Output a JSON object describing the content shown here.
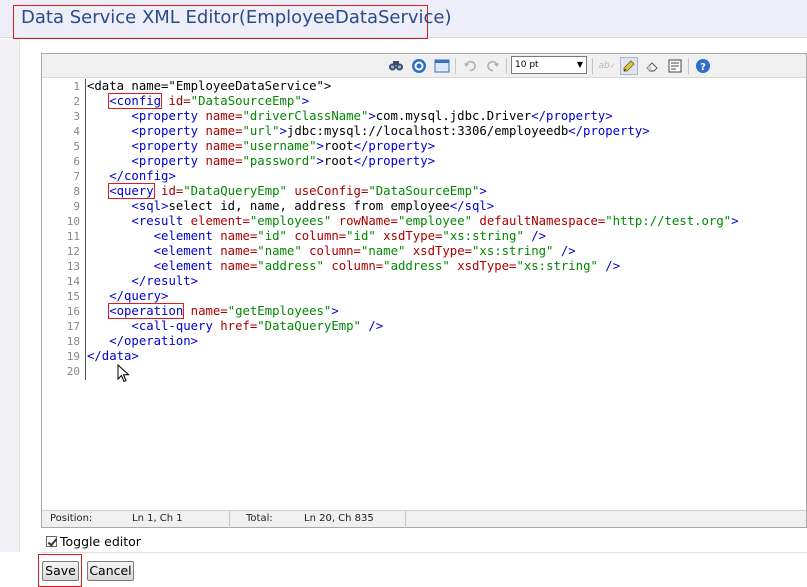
{
  "page": {
    "title": "Data Service XML Editor(EmployeeDataService)"
  },
  "toolbar": {
    "font_size": "10 pt",
    "buttons": [
      {
        "name": "find-icon",
        "glyph": "🔍"
      },
      {
        "name": "goto-line-icon",
        "glyph": "◉"
      },
      {
        "name": "fullscreen-icon",
        "glyph": "▭"
      },
      {
        "name": "undo-icon",
        "glyph": "↶"
      },
      {
        "name": "redo-icon",
        "glyph": "↷"
      },
      {
        "name": "spellcheck-icon",
        "glyph": "ab"
      },
      {
        "name": "highlight-icon",
        "glyph": "✎"
      },
      {
        "name": "reset-highlight-icon",
        "glyph": "⌫"
      },
      {
        "name": "word-wrap-icon",
        "glyph": "▤"
      },
      {
        "name": "help-icon",
        "glyph": "?"
      }
    ]
  },
  "editor": {
    "line_numbers": [
      "1",
      "2",
      "3",
      "4",
      "5",
      "6",
      "7",
      "8",
      "9",
      "10",
      "11",
      "12",
      "13",
      "14",
      "15",
      "16",
      "17",
      "18",
      "19",
      "20"
    ],
    "lines": [
      [
        [
          "x",
          "<data name=\"EmployeeDataService\">"
        ]
      ],
      [
        [
          "x",
          "   "
        ],
        [
          "t",
          "<config",
          "hl"
        ],
        [
          "a",
          " id="
        ],
        [
          "v",
          "\"DataSourceEmp\""
        ],
        [
          "t",
          ">"
        ]
      ],
      [
        [
          "x",
          "      "
        ],
        [
          "t",
          "<property"
        ],
        [
          "a",
          " name="
        ],
        [
          "v",
          "\"driverClassName\""
        ],
        [
          "t",
          ">"
        ],
        [
          "x",
          "com.mysql.jdbc.Driver"
        ],
        [
          "t",
          "</property>"
        ]
      ],
      [
        [
          "x",
          "      "
        ],
        [
          "t",
          "<property"
        ],
        [
          "a",
          " name="
        ],
        [
          "v",
          "\"url\""
        ],
        [
          "t",
          ">"
        ],
        [
          "x",
          "jdbc:mysql://localhost:3306/employeedb"
        ],
        [
          "t",
          "</property>"
        ]
      ],
      [
        [
          "x",
          "      "
        ],
        [
          "t",
          "<property"
        ],
        [
          "a",
          " name="
        ],
        [
          "v",
          "\"username\""
        ],
        [
          "t",
          ">"
        ],
        [
          "x",
          "root"
        ],
        [
          "t",
          "</property>"
        ]
      ],
      [
        [
          "x",
          "      "
        ],
        [
          "t",
          "<property"
        ],
        [
          "a",
          " name="
        ],
        [
          "v",
          "\"password\""
        ],
        [
          "t",
          ">"
        ],
        [
          "x",
          "root"
        ],
        [
          "t",
          "</property>"
        ]
      ],
      [
        [
          "x",
          "   "
        ],
        [
          "t",
          "</config>"
        ]
      ],
      [
        [
          "x",
          "   "
        ],
        [
          "t",
          "<query",
          "hl"
        ],
        [
          "a",
          " id="
        ],
        [
          "v",
          "\"DataQueryEmp\""
        ],
        [
          "a",
          " useConfig="
        ],
        [
          "v",
          "\"DataSourceEmp\""
        ],
        [
          "t",
          ">"
        ]
      ],
      [
        [
          "x",
          "      "
        ],
        [
          "t",
          "<sql>"
        ],
        [
          "x",
          "select id, name, address from employee"
        ],
        [
          "t",
          "</sql>"
        ]
      ],
      [
        [
          "x",
          "      "
        ],
        [
          "t",
          "<result"
        ],
        [
          "a",
          " element="
        ],
        [
          "v",
          "\"employees\""
        ],
        [
          "a",
          " rowName="
        ],
        [
          "v",
          "\"employee\""
        ],
        [
          "a",
          " defaultNamespace="
        ],
        [
          "v",
          "\"http://test.org\""
        ],
        [
          "t",
          ">"
        ]
      ],
      [
        [
          "x",
          "         "
        ],
        [
          "t",
          "<element"
        ],
        [
          "a",
          " name="
        ],
        [
          "v",
          "\"id\""
        ],
        [
          "a",
          " column="
        ],
        [
          "v",
          "\"id\""
        ],
        [
          "a",
          " xsdType="
        ],
        [
          "v",
          "\"xs:string\""
        ],
        [
          "t",
          " />"
        ]
      ],
      [
        [
          "x",
          "         "
        ],
        [
          "t",
          "<element"
        ],
        [
          "a",
          " name="
        ],
        [
          "v",
          "\"name\""
        ],
        [
          "a",
          " column="
        ],
        [
          "v",
          "\"name\""
        ],
        [
          "a",
          " xsdType="
        ],
        [
          "v",
          "\"xs:string\""
        ],
        [
          "t",
          " />"
        ]
      ],
      [
        [
          "x",
          "         "
        ],
        [
          "t",
          "<element"
        ],
        [
          "a",
          " name="
        ],
        [
          "v",
          "\"address\""
        ],
        [
          "a",
          " column="
        ],
        [
          "v",
          "\"address\""
        ],
        [
          "a",
          " xsdType="
        ],
        [
          "v",
          "\"xs:string\""
        ],
        [
          "t",
          " />"
        ]
      ],
      [
        [
          "x",
          "      "
        ],
        [
          "t",
          "</result>"
        ]
      ],
      [
        [
          "x",
          "   "
        ],
        [
          "t",
          "</query>"
        ]
      ],
      [
        [
          "x",
          "   "
        ],
        [
          "t",
          "<operation",
          "hl"
        ],
        [
          "a",
          " name="
        ],
        [
          "v",
          "\"getEmployees\""
        ],
        [
          "t",
          ">"
        ]
      ],
      [
        [
          "x",
          "      "
        ],
        [
          "t",
          "<call-query"
        ],
        [
          "a",
          " href="
        ],
        [
          "v",
          "\"DataQueryEmp\""
        ],
        [
          "t",
          " />"
        ]
      ],
      [
        [
          "x",
          "   "
        ],
        [
          "t",
          "</operation>"
        ]
      ],
      [
        [
          "t",
          "</data>"
        ]
      ],
      [
        [
          "x",
          ""
        ]
      ]
    ]
  },
  "status": {
    "position_label": "Position:",
    "position_value": "Ln 1, Ch 1",
    "total_label": "Total:",
    "total_value": "Ln 20, Ch 835"
  },
  "toggle_editor": {
    "label": "Toggle editor",
    "checked": true
  },
  "buttons": {
    "save": "Save",
    "cancel": "Cancel"
  },
  "colors": {
    "tag": "#0000cc",
    "attribute": "#aa0000",
    "value": "#008800",
    "highlight_box": "#d61f1f",
    "title": "#2a4a8a"
  }
}
